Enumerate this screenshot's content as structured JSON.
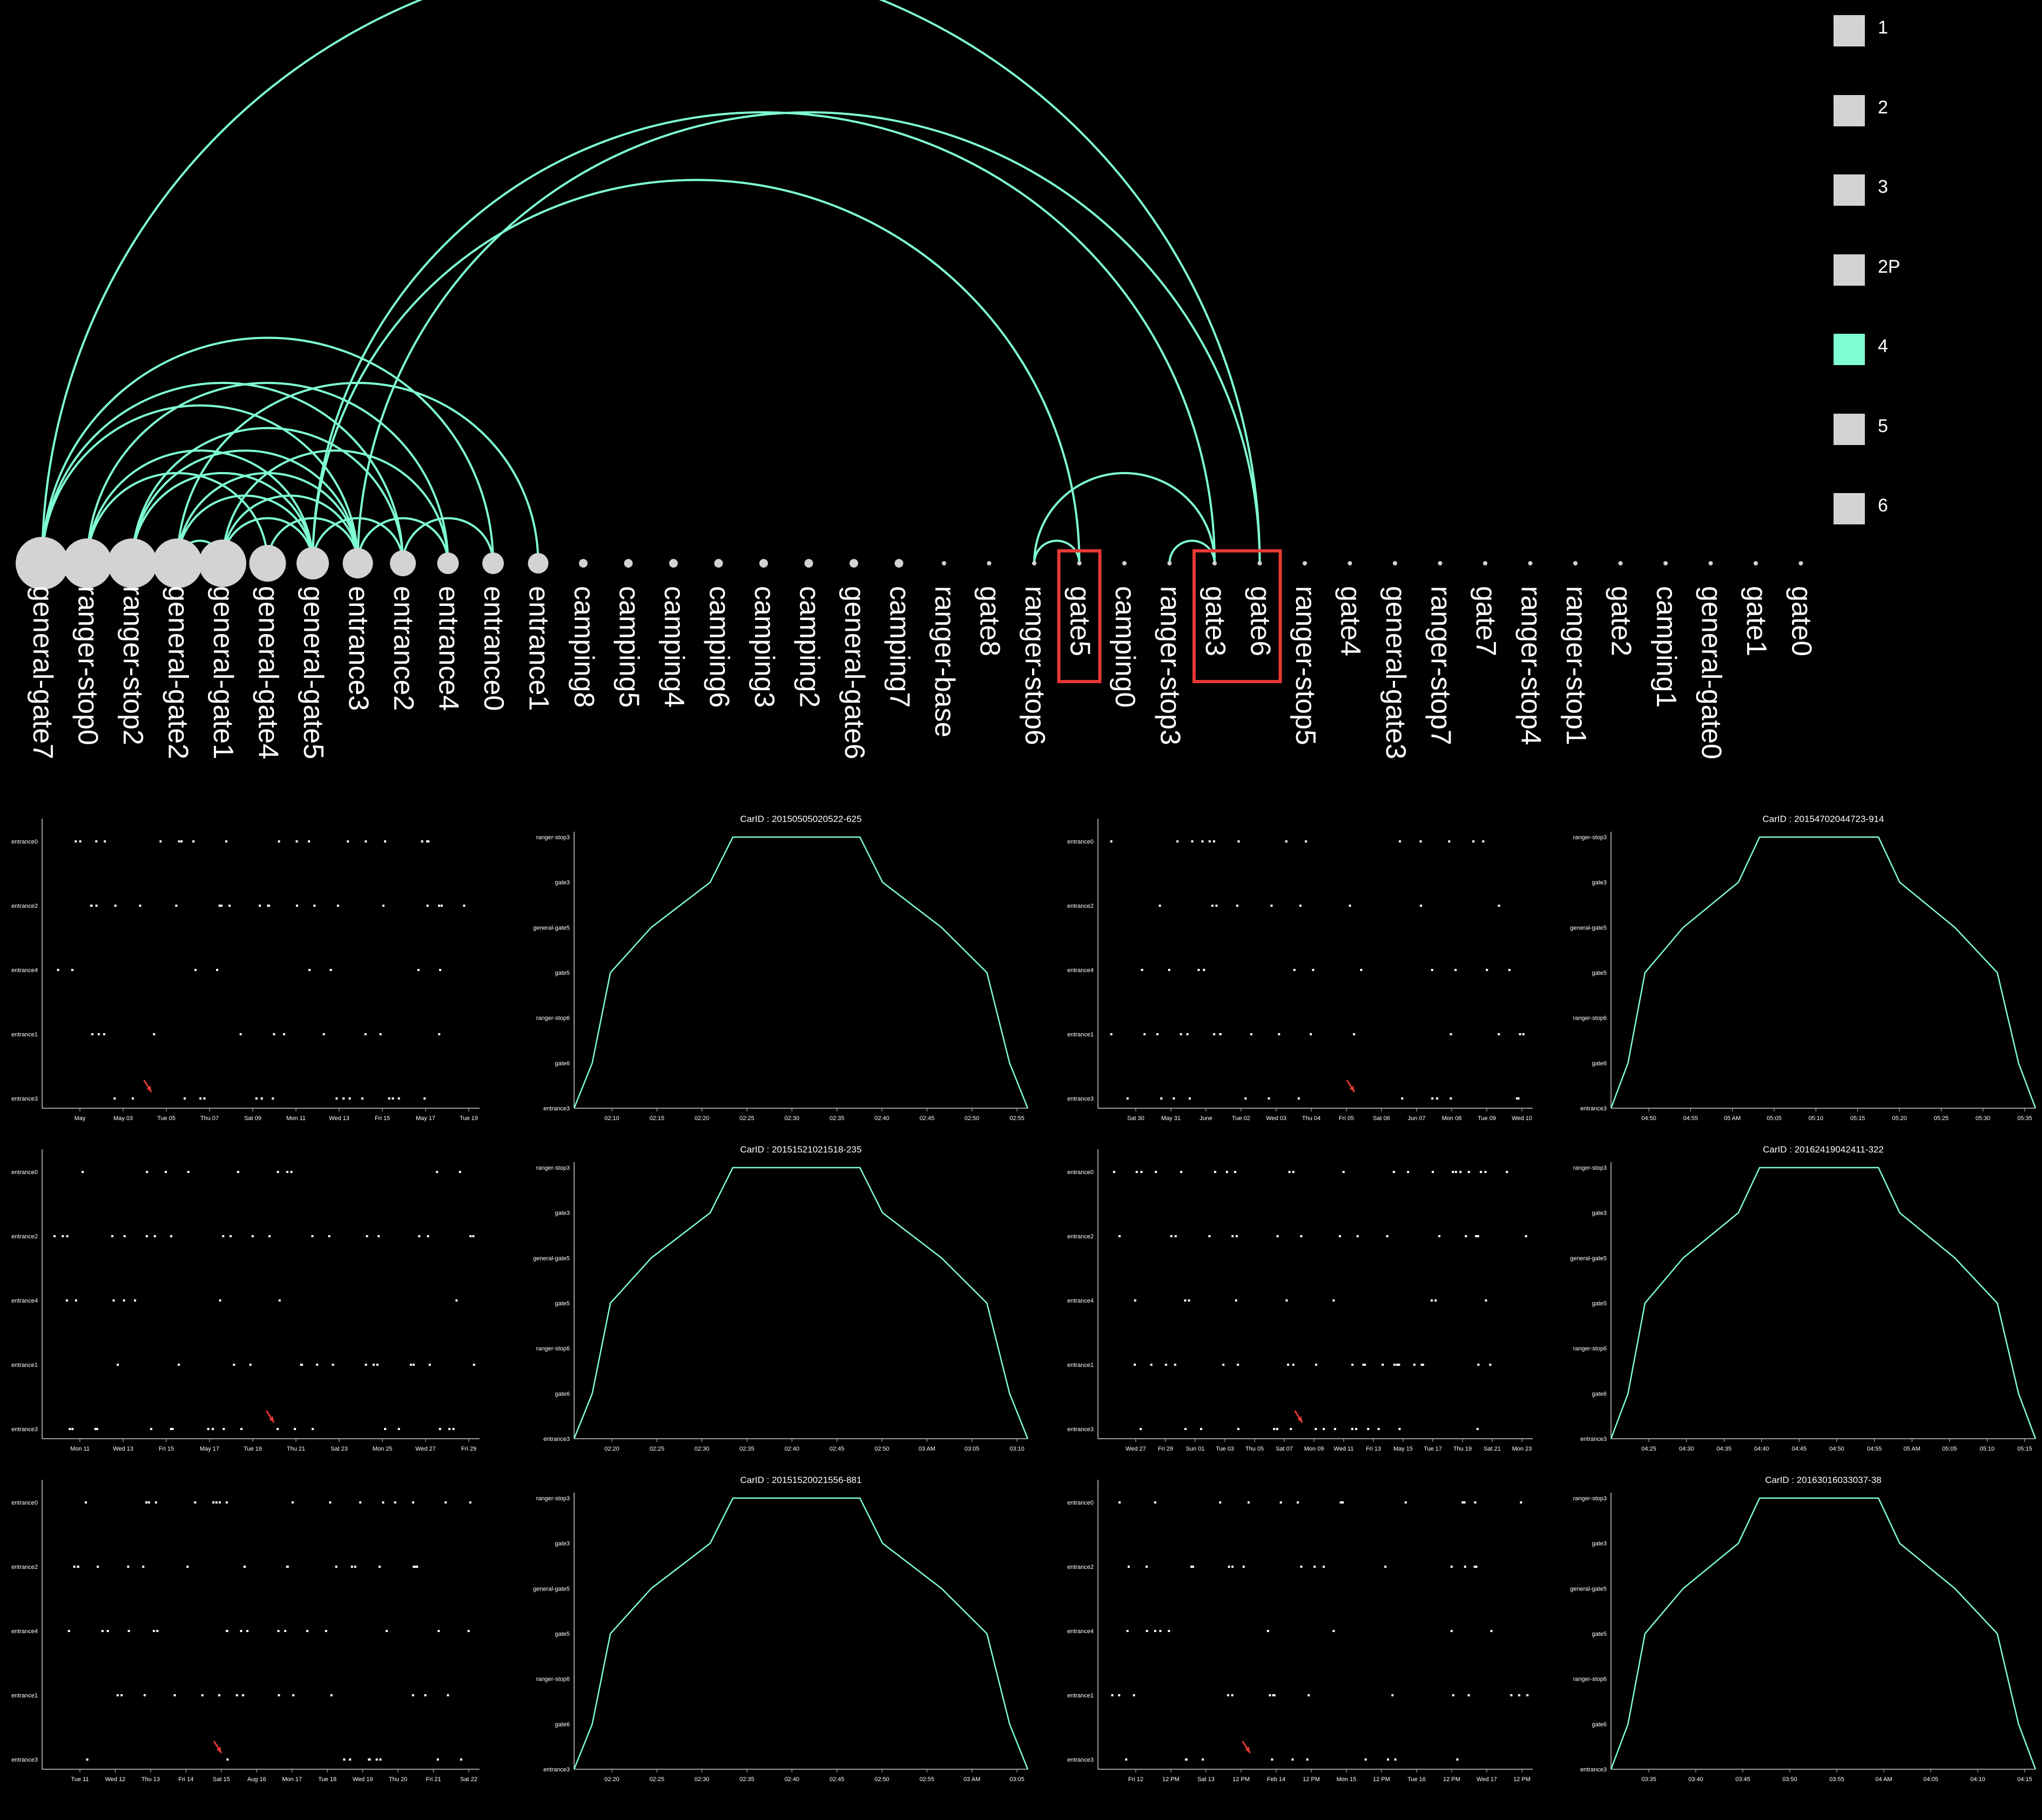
{
  "arc_diagram": {
    "nodes": [
      "general-gate7",
      "ranger-stop0",
      "ranger-stop2",
      "general-gate2",
      "general-gate1",
      "general-gate4",
      "general-gate5",
      "entrance3",
      "entrance2",
      "entrance4",
      "entrance0",
      "entrance1",
      "camping8",
      "camping5",
      "camping4",
      "camping6",
      "camping3",
      "camping2",
      "general-gate6",
      "camping7",
      "ranger-base",
      "gate8",
      "ranger-stop6",
      "gate5",
      "camping0",
      "ranger-stop3",
      "gate3",
      "gate6",
      "ranger-stop5",
      "gate4",
      "general-gate3",
      "ranger-stop7",
      "gate7",
      "ranger-stop4",
      "ranger-stop1",
      "gate2",
      "camping1",
      "general-gate0",
      "gate1",
      "gate0"
    ],
    "highlighted_nodes": [
      "gate5",
      "gate3",
      "gate6"
    ],
    "link_color": "#7fffd4",
    "node_color": "#d3d3d3",
    "highlight_color": "#e53935"
  },
  "legend": {
    "items": [
      {
        "label": "1",
        "color": "#d3d3d3"
      },
      {
        "label": "2",
        "color": "#d3d3d3"
      },
      {
        "label": "3",
        "color": "#d3d3d3"
      },
      {
        "label": "2P",
        "color": "#d3d3d3"
      },
      {
        "label": "4",
        "color": "#7fffd4"
      },
      {
        "label": "5",
        "color": "#d3d3d3"
      },
      {
        "label": "6",
        "color": "#d3d3d3"
      }
    ]
  },
  "timeline_rows": [
    "entrance0",
    "entrance2",
    "entrance4",
    "entrance1",
    "entrance3"
  ],
  "path_rows": [
    "ranger-stop3",
    "gate3",
    "general-gate5",
    "gate5",
    "ranger-stop6",
    "gate6",
    "entrance3"
  ],
  "panels": [
    {
      "type": "timeline",
      "ticks": [
        "May",
        "May 03",
        "Tue 05",
        "Thu 07",
        "Sat 09",
        "Mon 11",
        "Wed 13",
        "Fri 15",
        "May 17",
        "Tue 19"
      ]
    },
    {
      "type": "path",
      "title": "CarID : 20150505020522-625",
      "ticks": [
        "02:10",
        "02:15",
        "02:20",
        "02:25",
        "02:30",
        "02:35",
        "02:40",
        "02:45",
        "02:50",
        "02:55"
      ]
    },
    {
      "type": "timeline",
      "ticks": [
        "Sat 30",
        "May 31",
        "June",
        "Tue 02",
        "Wed 03",
        "Thu 04",
        "Fri 05",
        "Sat 06",
        "Jun 07",
        "Mon 08",
        "Tue 09",
        "Wed 10"
      ]
    },
    {
      "type": "path",
      "title": "CarID : 20154702044723-914",
      "ticks": [
        "04:50",
        "04:55",
        "05 AM",
        "05:05",
        "05:10",
        "05:15",
        "05:20",
        "05:25",
        "05:30",
        "05:35"
      ]
    },
    {
      "type": "timeline",
      "ticks": [
        "Mon 11",
        "Wed 13",
        "Fri 15",
        "May 17",
        "Tue 19",
        "Thu 21",
        "Sat 23",
        "Mon 25",
        "Wed 27",
        "Fri 29"
      ]
    },
    {
      "type": "path",
      "title": "CarID : 20151521021518-235",
      "ticks": [
        "02:20",
        "02:25",
        "02:30",
        "02:35",
        "02:40",
        "02:45",
        "02:50",
        "03 AM",
        "03:05",
        "03:10"
      ]
    },
    {
      "type": "timeline",
      "ticks": [
        "Wed 27",
        "Fri 29",
        "Sun 01",
        "Tue 03",
        "Thu 05",
        "Sat 07",
        "Mon 09",
        "Wed 11",
        "Fri 13",
        "May 15",
        "Tue 17",
        "Thu 19",
        "Sat 21",
        "Mon 23"
      ]
    },
    {
      "type": "path",
      "title": "CarID : 20162419042411-322",
      "ticks": [
        "04:25",
        "04:30",
        "04:35",
        "04:40",
        "04:45",
        "04:50",
        "04:55",
        "05 AM",
        "05:05",
        "05:10",
        "05:15"
      ]
    },
    {
      "type": "timeline",
      "ticks": [
        "Tue 11",
        "Wed 12",
        "Thu 13",
        "Fri 14",
        "Sat 15",
        "Aug 16",
        "Mon 17",
        "Tue 18",
        "Wed 19",
        "Thu 20",
        "Fri 21",
        "Sat 22"
      ]
    },
    {
      "type": "path",
      "title": "CarID : 20151520021556-881",
      "ticks": [
        "02:20",
        "02:25",
        "02:30",
        "02:35",
        "02:40",
        "02:45",
        "02:50",
        "02:55",
        "03 AM",
        "03:05"
      ]
    },
    {
      "type": "timeline",
      "ticks": [
        "Fri 12",
        "12 PM",
        "Sat 13",
        "12 PM",
        "Feb 14",
        "12 PM",
        "Mon 15",
        "12 PM",
        "Tue 16",
        "12 PM",
        "Wed 17",
        "12 PM"
      ]
    },
    {
      "type": "path",
      "title": "CarID : 20163016033037-38",
      "ticks": [
        "03:35",
        "03:40",
        "03:45",
        "03:50",
        "03:55",
        "04 AM",
        "04:05",
        "04:10",
        "04:15"
      ]
    }
  ]
}
